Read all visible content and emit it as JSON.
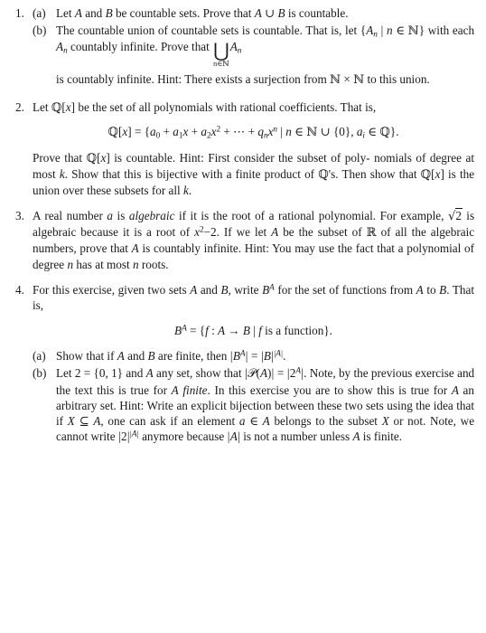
{
  "document": {
    "type": "math-problem-set",
    "items": [
      {
        "number": "1.",
        "subitems": [
          {
            "label": "(a)",
            "text": "Let A and B be countable sets. Prove that A ∪ B is countable."
          },
          {
            "label": "(b)",
            "text_part1": "The countable union of countable sets is countable. That is, let {Aₙ | n ∈ ℕ} with each Aₙ countably infinite. Prove that",
            "bigop_glyph": "⋃",
            "bigop_limit": "n∈ℕ",
            "bigop_operand": "Aₙ",
            "text_part2": "is countably infinite. Hint: There exists a surjection from ℕ × ℕ to this union."
          }
        ]
      },
      {
        "number": "2.",
        "intro": "Let ℚ[x] be the set of all polynomials with rational coefficients. That is,",
        "equation": "ℚ[x] = {a₀ + a₁x + a₂x² + ⋯ + qₙxⁿ | n ∈ ℕ ∪ {0}, aᵢ ∈ ℚ}.",
        "body": "Prove that ℚ[x] is countable. Hint: First consider the subset of polynomials of degree at most k. Show that this is bijective with a finite product of ℚ's. Then show that ℚ[x] is the union over these subsets for all k."
      },
      {
        "number": "3.",
        "body": "A real number a is algebraic if it is the root of a rational polynomial. For example, √2 is algebraic because it is a root of x²−2. If we let A be the subset of ℝ of all the algebraic numbers, prove that A is countably infinite. Hint: You may use the fact that a polynomial of degree n has at most n roots.",
        "emphasis": "algebraic"
      },
      {
        "number": "4.",
        "intro": "For this exercise, given two sets A and B, write Bᴬ for the set of functions from A to B. That is,",
        "equation": "Bᴬ = {f : A → B | f is a function}.",
        "subitems": [
          {
            "label": "(a)",
            "text": "Show that if A and B are finite, then |Bᴬ| = |B|^|A|."
          },
          {
            "label": "(b)",
            "text": "Let 2 = {0, 1} and A any set, show that |𝒫(A)| = |2ᴬ|. Note, by the previous exercise and the text this is true for A finite. In this exercise you are to show this is true for A an arbitrary set. Hint: Write an explicit bijection between these two sets using the idea that if X ⊆ A, one can ask if an element a ∈ A belongs to the subset X or not. Note, we cannot write |2|^|A| anymore because |A| is not a number unless A is finite.",
            "emphasis": "finite"
          }
        ]
      }
    ]
  },
  "words": {
    "let": "Let",
    "and": "and",
    "be_countable_sets": "be countable sets. Prove that",
    "is_countable": "is countable.",
    "b_line1": "The countable union of countable sets is countable. That is, let",
    "b_with_each": "with each",
    "b_countably_inf": "countably infinite. Prove that",
    "b_line3": "is countably infinite. Hint: There exists a surjection from",
    "b_to_this_union": "to this union.",
    "q2_intro_a": "Let",
    "q2_intro_b": "be the set of all polynomials with rational coefficients. That",
    "q2_intro_c": "is,",
    "q2_body_a": "Prove that",
    "q2_body_b": "is countable. Hint: First consider the subset of poly-",
    "q2_body_c": "nomials of degree at most",
    "q2_body_d": ". Show that this is bijective with a finite",
    "q2_body_e": "product of",
    "q2_body_f": "'s. Then show that",
    "q2_body_g": "is the union over these subsets",
    "q2_body_h": "for all",
    "q3_a": "A real number",
    "q3_is": "is",
    "q3_algebraic": "algebraic",
    "q3_b": "if it is the root of a rational polynomial.",
    "q3_c": "For example,",
    "q3_d": "is algebraic because it is a root of",
    "q3_e": ". If we let",
    "q3_f": "be",
    "q3_g": "the subset of",
    "q3_h": "of all the algebraic numbers, prove that",
    "q3_i": "is countably",
    "q3_j": "infinite. Hint: You may use the fact that a polynomial of degree",
    "q3_k": "has",
    "q3_l": "at most",
    "q3_m": "roots.",
    "q4_a": "For this exercise, given two sets",
    "q4_b": "and",
    "q4_c": ", write",
    "q4_d": "for the set of",
    "q4_e": "functions from",
    "q4_f": "to",
    "q4_g": ". That is,",
    "q4a_a": "Show that if",
    "q4a_b": "and",
    "q4a_c": "are finite, then",
    "q4b_1": "Let 2 =",
    "q4b_2": "and",
    "q4b_3": "any set, show that",
    "q4b_4": ". Note, by",
    "q4b_5": "the previous exercise and the text this is true for",
    "q4b_6": "finite",
    "q4b_7": ". In this",
    "q4b_8": "exercise you are to show this is true for",
    "q4b_9": "an arbitrary set. Hint:",
    "q4b_10": "Write an explicit bijection between these two sets using the idea",
    "q4b_11": "that if",
    "q4b_12": ", one can ask if an element",
    "q4b_13": "belongs to the",
    "q4b_14": "subset",
    "q4b_15": "or not. Note, we cannot write",
    "q4b_16": "anymore because",
    "q4b_17": "is not a number unless",
    "q4b_18": "is finite.",
    "is_a_function": "is a function}."
  },
  "symbols": {
    "num1": "1.",
    "num2": "2.",
    "num3": "3.",
    "num4": "4.",
    "lbl_a": "(a)",
    "lbl_b": "(b)",
    "A": "A",
    "B": "B",
    "a": "a",
    "f": "f",
    "k": "k",
    "n": "n",
    "x": "x",
    "X": "X",
    "cup": "∪",
    "bigcup": "⋃",
    "in": "∈",
    "subseteq": "⊆",
    "times": "×",
    "to": "→",
    "eq": "=",
    "plus": "+",
    "cdots": "⋯",
    "comma": ",",
    "colon": ":",
    "mid": "|",
    "lbrace": "{",
    "rbrace": "}",
    "lbrack": "[",
    "rbrack": "]",
    "lparen": "(",
    "rparen": ")",
    "minus": "−",
    "period": ".",
    "zero": "0",
    "one": "1",
    "two": "2",
    "NN": "ℕ",
    "QQ": "ℚ",
    "RR": "ℝ",
    "PP": "𝒫",
    "radical": "√",
    "limit_nN": "n∈ℕ"
  }
}
